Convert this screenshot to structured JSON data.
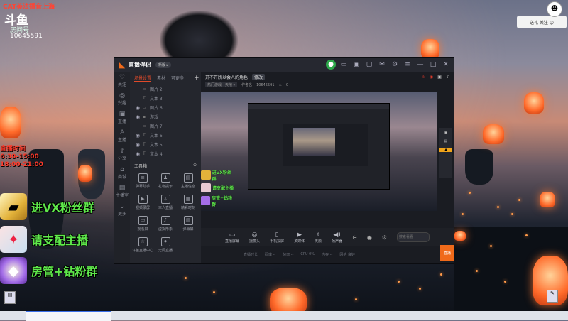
{
  "stream": {
    "top_notice": "CAT英法播音上海",
    "brand": "斗鱼",
    "room_label": "房间号",
    "room_number": "10645591",
    "time_label": "直播时间",
    "time_range_1": "6:30-15:00",
    "time_range_2": "18:00-21:00",
    "banners": [
      {
        "icon": "gold-bar-icon",
        "text": "进VX粉丝群"
      },
      {
        "icon": "pet-icon",
        "text": "请支配主播"
      },
      {
        "icon": "badge-icon",
        "text": "房管+钻粉群"
      }
    ],
    "top_right_note": "送礼 关注 ☺"
  },
  "app": {
    "title": "直播伴侣",
    "version_badge": "新版 ▸",
    "sidebar": [
      "关注",
      "兴趣",
      "直播",
      "主播",
      "分享",
      "商城",
      "主播室",
      "更多"
    ],
    "tabs": [
      {
        "label": "场景设置",
        "active": true
      },
      {
        "label": "素材",
        "active": false
      },
      {
        "label": "可更多",
        "active": false
      }
    ],
    "sources": [
      {
        "name": "图片 2"
      },
      {
        "name": "文本 3"
      },
      {
        "name": "图片 6"
      },
      {
        "name": "游戏"
      },
      {
        "name": "图片 7"
      },
      {
        "name": "文本 6"
      },
      {
        "name": "文本 5"
      },
      {
        "name": "文本 4"
      }
    ],
    "tools_header": "工具箱",
    "tools": [
      {
        "icon": "danmaku-icon",
        "label": "弹幕助手"
      },
      {
        "icon": "gift-icon",
        "label": "礼物提示"
      },
      {
        "icon": "message-icon",
        "label": "主播信息"
      },
      {
        "icon": "video-icon",
        "label": "视频录屏"
      },
      {
        "icon": "download-icon",
        "label": "本人直播"
      },
      {
        "icon": "calendar-icon",
        "label": "精彩时刻"
      },
      {
        "icon": "screen-icon",
        "label": "观看屏"
      },
      {
        "icon": "sound-icon",
        "label": "虚拟形象"
      },
      {
        "icon": "chart-icon",
        "label": "弹幕屏"
      },
      {
        "icon": "star-icon",
        "label": "斗鱼直播中心"
      },
      {
        "icon": "mic-icon",
        "label": "无问直播"
      }
    ],
    "stream_title": "开不开所以会人的角色",
    "edit_label": "修改",
    "category": "热门游戏 - 天地 ▾",
    "author": "作者名",
    "room": "10645591",
    "heat": "0",
    "mini_banners": [
      "进VX粉丝群",
      "请支配主播",
      "房管+钻粉群"
    ],
    "bottom_buttons": [
      {
        "icon": "screen-share-icon",
        "label": "直播屏幕"
      },
      {
        "icon": "camera-icon",
        "label": "摄像头"
      },
      {
        "icon": "phone-icon",
        "label": "手机投屏"
      },
      {
        "icon": "media-icon",
        "label": "多媒体"
      },
      {
        "icon": "effects-icon",
        "label": "美颜"
      },
      {
        "icon": "speaker-icon",
        "label": "扬声器"
      }
    ],
    "search_placeholder": "搜索看看",
    "status": [
      "直播时长",
      "码率 --",
      "帧率 --",
      "CPU 0%",
      "内存 --",
      "网络 良好"
    ],
    "start_button": "直播"
  },
  "colors": {
    "accent": "#f06a1a",
    "banner_text": "#5ee84a",
    "alert_red": "#e03a2a"
  }
}
